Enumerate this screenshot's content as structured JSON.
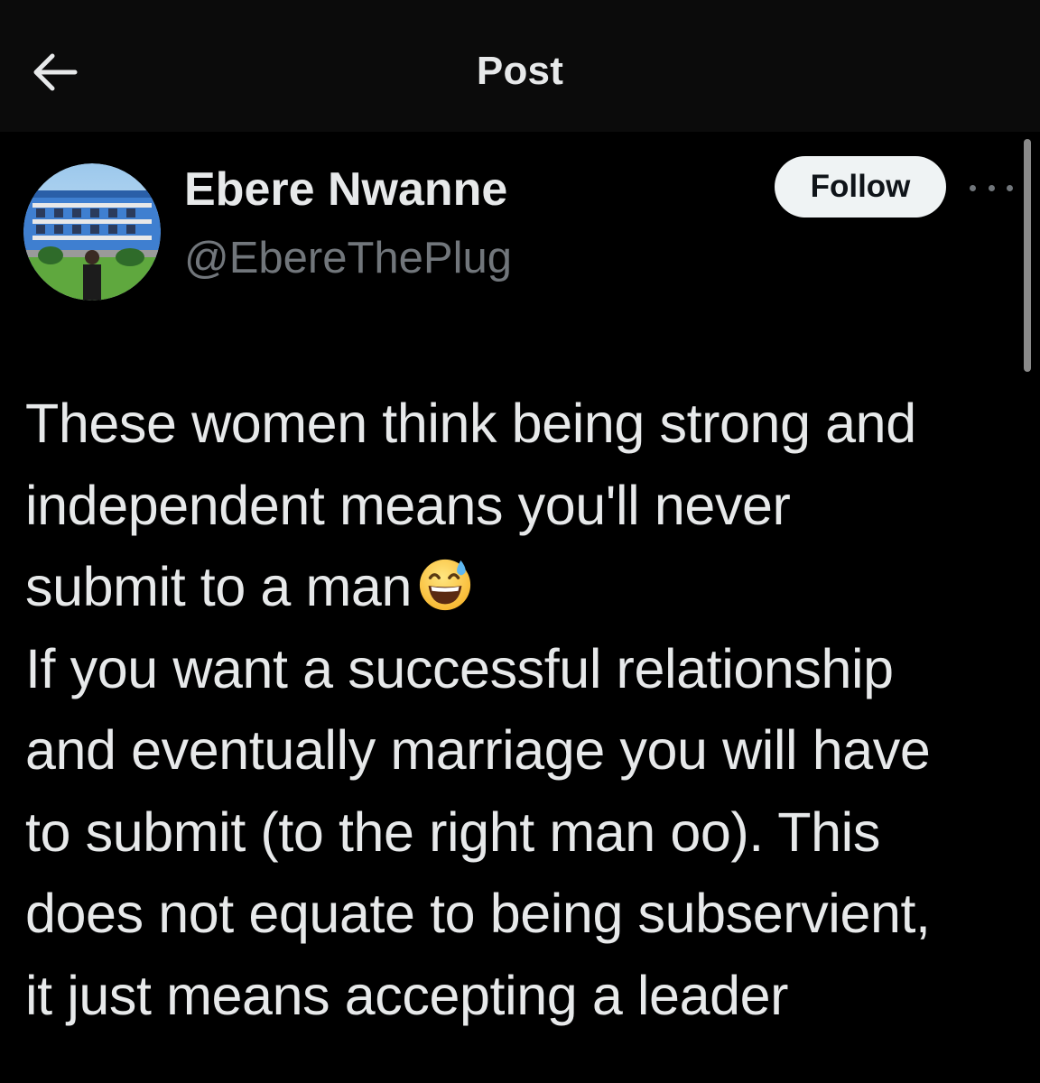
{
  "header": {
    "title": "Post",
    "back_icon": "arrow-left-icon"
  },
  "author": {
    "display_name": "Ebere Nwanne",
    "handle": "@EbereThePlug",
    "avatar_icon": "avatar-photo"
  },
  "actions": {
    "follow_label": "Follow",
    "more_icon": "more-horizontal-icon"
  },
  "post": {
    "lines": [
      "These women think being strong and",
      "independent means you'll never",
      "submit to a man",
      "If you want a successful relationship",
      "and eventually marriage you will have",
      "to submit (to the right man oo). This",
      "does not equate to being subservient,",
      "it just means accepting a leader"
    ],
    "emoji_icon": "grinning-sweat-emoji-icon"
  },
  "colors": {
    "background": "#000000",
    "header_background": "#0b0b0b",
    "primary_text": "#e7e9ea",
    "secondary_text": "#71767b",
    "follow_button_bg": "#eff3f4"
  }
}
